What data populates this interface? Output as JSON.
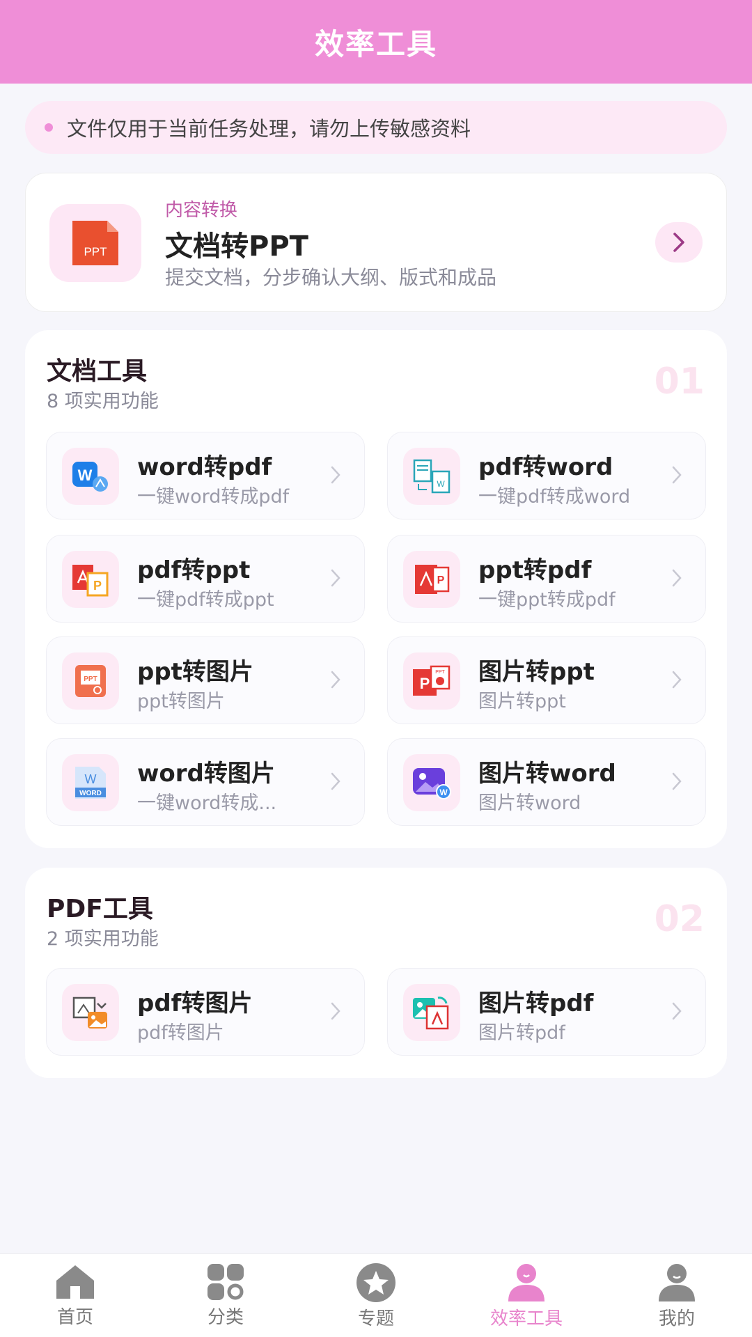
{
  "header": {
    "title": "效率工具"
  },
  "notice": {
    "text": "文件仅用于当前任务处理，请勿上传敏感资料"
  },
  "feature": {
    "tag": "内容转换",
    "title": "文档转PPT",
    "desc": "提交文档，分步确认大纲、版式和成品",
    "icon_text": "PPT"
  },
  "sections": {
    "docs": {
      "title": "文档工具",
      "subtitle": "8 项实用功能",
      "number": "01",
      "tools": [
        {
          "title": "word转pdf",
          "desc": "一键word转成pdf",
          "icon": "word-to-pdf-icon"
        },
        {
          "title": "pdf转word",
          "desc": "一键pdf转成word",
          "icon": "pdf-to-word-icon"
        },
        {
          "title": "pdf转ppt",
          "desc": "一键pdf转成ppt",
          "icon": "pdf-to-ppt-icon"
        },
        {
          "title": "ppt转pdf",
          "desc": "一键ppt转成pdf",
          "icon": "ppt-to-pdf-icon"
        },
        {
          "title": "ppt转图片",
          "desc": "ppt转图片",
          "icon": "ppt-to-image-icon"
        },
        {
          "title": "图片转ppt",
          "desc": "图片转ppt",
          "icon": "image-to-ppt-icon"
        },
        {
          "title": "word转图片",
          "desc": "一键word转成...",
          "icon": "word-to-image-icon"
        },
        {
          "title": "图片转word",
          "desc": "图片转word",
          "icon": "image-to-word-icon"
        }
      ]
    },
    "pdf": {
      "title": "PDF工具",
      "subtitle": "2 项实用功能",
      "number": "02",
      "tools": [
        {
          "title": "pdf转图片",
          "desc": "pdf转图片",
          "icon": "pdf-to-image-icon"
        },
        {
          "title": "图片转pdf",
          "desc": "图片转pdf",
          "icon": "image-to-pdf-icon"
        }
      ]
    }
  },
  "tabs": [
    {
      "label": "首页",
      "icon": "home-icon"
    },
    {
      "label": "分类",
      "icon": "category-icon"
    },
    {
      "label": "专题",
      "icon": "star-icon"
    },
    {
      "label": "效率工具",
      "icon": "tools-person-icon",
      "active": true
    },
    {
      "label": "我的",
      "icon": "profile-icon"
    }
  ],
  "colors": {
    "brand_pink": "#ef8ed7",
    "active_tab": "#e884cc"
  }
}
